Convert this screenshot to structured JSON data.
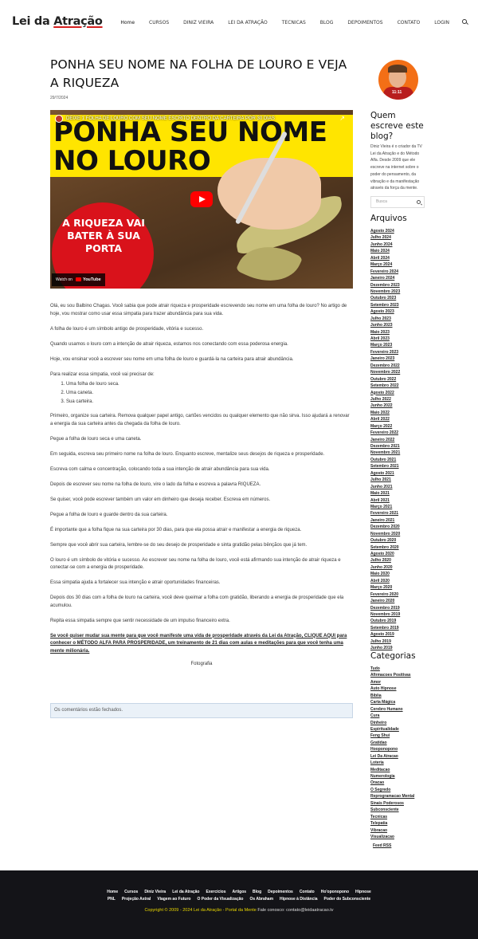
{
  "header": {
    "logo": {
      "pre": "Lei da ",
      "accent": "Atração"
    },
    "nav": [
      "Home",
      "CURSOS",
      "DINIZ VIEIRA",
      "LEI DA ATRAÇÃO",
      "TECNICAS",
      "BLOG",
      "DEPOIMENTOS",
      "CONTATO",
      "LOGIN"
    ]
  },
  "post": {
    "title": "PONHA SEU NOME NA FOLHA DE LOURO E VEJA A RIQUEZA",
    "date": "29/7/2024",
    "video": {
      "overlay_title": "DEIXE 1 FOLHA DE LOURO COM SEU NOME ESCRITO DENTRO DA CARTEIRA POR 30 DIAS",
      "thumb_line1": "PONHA SEU NOME",
      "thumb_line2": "NO LOURO",
      "circle_text": "A RIQUEZA VAI BATER À SUA PORTA",
      "watch_on": "Watch on",
      "yt_brand": "YouTube"
    },
    "paragraphs_a": [
      "Olá, eu sou Balbino Chagas. Você sabia que pode atrair riqueza e prosperidade escrevendo seu nome em uma folha de louro? No artigo de hoje, vou mostrar como usar essa simpatia para trazer abundância para sua vida.",
      "A folha de louro é um símbolo antigo de prosperidade, vitória e sucesso.",
      "Quando usamos o louro com a intenção de atrair riqueza, estamos nos conectando com essa poderosa energia.",
      "Hoje, vou ensinar você a escrever seu nome em uma folha de louro e guardá-la na carteira para atrair abundância.",
      "Para realizar essa simpatia, você vai precisar de:"
    ],
    "list": [
      "Uma folha de louro seca.",
      "Uma caneta.",
      "Sua carteira."
    ],
    "paragraphs_b": [
      "Primeiro, organize sua carteira. Remova qualquer papel antigo, cartões vencidos ou qualquer elemento que não sirva. Isso ajudará a renovar a energia da sua carteira antes da chegada da folha de louro.",
      "Pegue a folha de louro seca e uma caneta.",
      "Em seguida, escreva seu primeiro nome na folha de louro. Enquanto escreve, mentalize seus desejos de riqueza e prosperidade.",
      "Escreva com calma e concentração, colocando toda a sua intenção de atrair abundância para sua vida.",
      "Depois de escrever seu nome na folha de louro, vire o lado da folha e escreva a palavra RIQUEZA.",
      "Se quiser, você pode escrever também um valor em dinheiro que deseja receber. Escreva em números.",
      "Pegue a folha de louro e guarde dentro da sua carteira.",
      "É importante que a folha fique na sua carteira por 30 dias, para que ela possa atrair e manifestar a energia de riqueza.",
      "Sempre que você abrir sua carteira, lembre-se do seu desejo de prosperidade e sinta gratidão pelas bênçãos que já tem.",
      "O louro é um símbolo de vitória e sucesso. Ao escrever seu nome na folha de louro, você está afirmando sua intenção de atrair riqueza e conectar-se com a energia de prosperidade.",
      "Essa simpatia ajuda a fortalecer sua intenção e atrair oportunidades financeiras.",
      "Depois dos 30 dias com a folha de louro na carteira, você deve queimar a folha com gratidão, liberando a energia de prosperidade que ela acumulou.",
      "Repita essa simpatia sempre que sentir necessidade de um impulso financeiro extra."
    ],
    "cta": "Se você quiser mudar sua mente para que você manifeste uma vida de prosperidade através da Lei da Atração, CLIQUE AQUI para conhecer o MÉTODO ALFA PARA PROSPERIDADE, um treinamento de 21 dias com aulas e meditações para que você tenha uma mente milionária.",
    "photo_alt": "Fotografia",
    "comments_closed": "Os comentários estão fechados."
  },
  "sidebar": {
    "avatar_shirt": "11:11",
    "who_title": "Quem escreve este blog?",
    "who_desc": "Diniz Vieira é o criador da TV Lei da Atração e do Método Alfa. Desde 2009 que ele escreve na internet sobre o poder do pensamento, da vibração e da manifestação através da força da mente.",
    "search_placeholder": "Busca",
    "archives_title": "Arquivos",
    "archives": [
      "Agosto 2024",
      "Julho 2024",
      "Junho 2024",
      "Maio 2024",
      "Abril 2024",
      "Março 2024",
      "Fevereiro 2024",
      "Janeiro 2024",
      "Dezembro 2023",
      "Novembro 2023",
      "Outubro 2023",
      "Setembro 2023",
      "Agosto 2023",
      "Julho 2023",
      "Junho 2023",
      "Maio 2023",
      "Abril 2023",
      "Março 2023",
      "Fevereiro 2023",
      "Janeiro 2023",
      "Dezembro 2022",
      "Novembro 2022",
      "Outubro 2022",
      "Setembro 2022",
      "Agosto 2022",
      "Julho 2022",
      "Junho 2022",
      "Maio 2022",
      "Abril 2022",
      "Março 2022",
      "Fevereiro 2022",
      "Janeiro 2022",
      "Dezembro 2021",
      "Novembro 2021",
      "Outubro 2021",
      "Setembro 2021",
      "Agosto 2021",
      "Julho 2021",
      "Junho 2021",
      "Maio 2021",
      "Abril 2021",
      "Março 2021",
      "Fevereiro 2021",
      "Janeiro 2021",
      "Dezembro 2020",
      "Novembro 2020",
      "Outubro 2020",
      "Setembro 2020",
      "Agosto 2020",
      "Julho 2020",
      "Junho 2020",
      "Maio 2020",
      "Abril 2020",
      "Março 2020",
      "Fevereiro 2020",
      "Janeiro 2020",
      "Dezembro 2019",
      "Novembro 2019",
      "Outubro 2019",
      "Setembro 2019",
      "Agosto 2019",
      "Julho 2019",
      "Junho 2019"
    ],
    "categories_title": "Categorias",
    "categories": [
      "Tudo",
      "Afirmacoes Positivas",
      "Amor",
      "Auto Hipnose",
      "Bíblia",
      "Carta Mágica",
      "Cerebro Humano",
      "Cura",
      "Dinheiro",
      "Espiritualidade",
      "Feng Shui",
      "Gratidao",
      "Hooponopono",
      "Lei Da Atracao",
      "Loteria",
      "Meditacao",
      "Numerologia",
      "Oracao",
      "O Segredo",
      "Reprogramacao Mental",
      "Sinais Poderosos",
      "Subconsciente",
      "Tecnicas",
      "Telepatia",
      "Vibracao",
      "Visualizacao"
    ],
    "feed": "Feed RSS"
  },
  "footer": {
    "row1": [
      "Home",
      "Cursos",
      "Diniz Vieira",
      "Lei da Atração",
      "Exercícios",
      "Artigos",
      "Blog",
      "Depoimentos",
      "Contato",
      "Ho'oponopono",
      "Hipnose"
    ],
    "row2": [
      "PNL",
      "Projeção Astral",
      "Viagem ao Futuro",
      "O Poder da Visualização",
      "Os Abraham",
      "Hipnose à Distância",
      "Poder do Subconsciente"
    ],
    "copyright": "Copyright © 2009 - 2024 Lei da Atração - Portal da Mente",
    "contact": "Fale conosco: contato@leidaatracao.tv"
  }
}
